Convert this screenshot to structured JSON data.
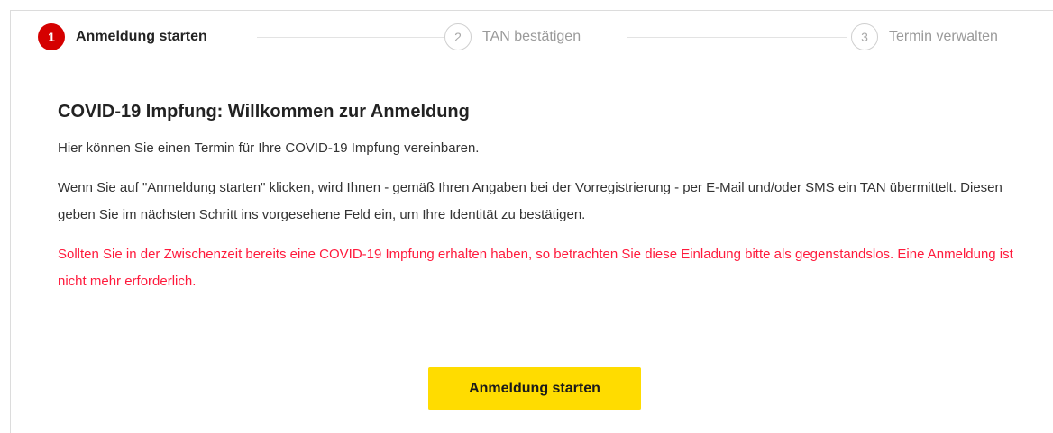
{
  "stepper": {
    "steps": [
      {
        "number": "1",
        "label": "Anmeldung starten",
        "state": "active"
      },
      {
        "number": "2",
        "label": "TAN bestätigen",
        "state": "inactive"
      },
      {
        "number": "3",
        "label": "Termin verwalten",
        "state": "inactive"
      }
    ]
  },
  "main": {
    "title": "COVID-19 Impfung: Willkommen zur Anmeldung",
    "intro": "Hier können Sie einen Termin für Ihre COVID-19 Impfung vereinbaren.",
    "info": "Wenn Sie auf \"Anmeldung starten\" klicken, wird Ihnen - gemäß Ihren Angaben bei der Vorregistrierung - per E-Mail und/oder SMS ein TAN übermittelt. Diesen geben Sie im nächsten Schritt ins vorgesehene Feld ein, um Ihre Identität zu bestätigen.",
    "warning": "Sollten Sie in der Zwischenzeit bereits eine COVID-19 Impfung erhalten haben, so betrachten Sie diese Einladung bitte als gegenstandslos. Eine Anmeldung ist nicht mehr erforderlich.",
    "start_button_label": "Anmeldung starten"
  },
  "colors": {
    "active_step": "#d50000",
    "warning_text": "#ff1a3c",
    "button": "#ffdc00"
  }
}
